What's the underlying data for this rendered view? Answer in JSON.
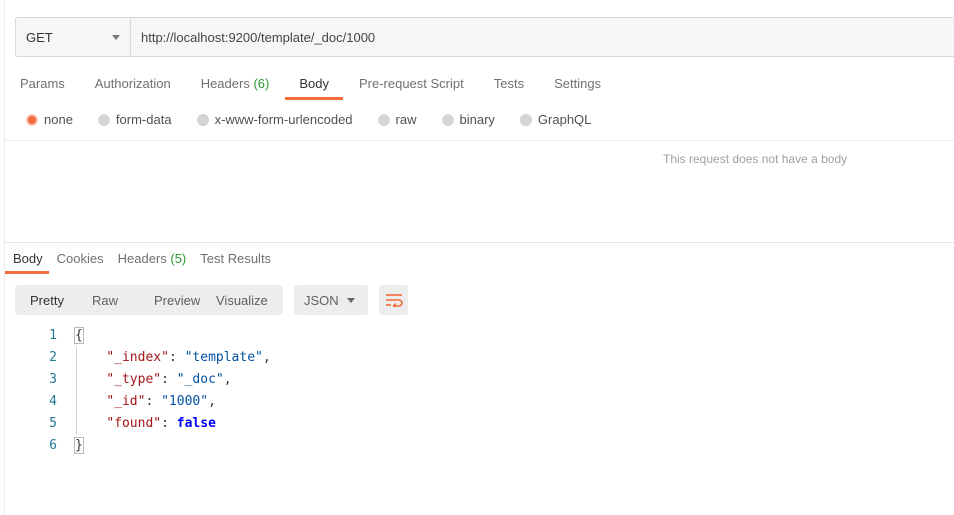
{
  "request": {
    "method": "GET",
    "url": "http://localhost:9200/template/_doc/1000"
  },
  "request_tabs": [
    {
      "label": "Params"
    },
    {
      "label": "Authorization"
    },
    {
      "label": "Headers",
      "count": "(6)"
    },
    {
      "label": "Body",
      "active": true
    },
    {
      "label": "Pre-request Script"
    },
    {
      "label": "Tests"
    },
    {
      "label": "Settings"
    }
  ],
  "body_types": [
    {
      "label": "none",
      "selected": true
    },
    {
      "label": "form-data"
    },
    {
      "label": "x-www-form-urlencoded"
    },
    {
      "label": "raw"
    },
    {
      "label": "binary"
    },
    {
      "label": "GraphQL"
    }
  ],
  "no_body_message": "This request does not have a body",
  "response_tabs": [
    {
      "label": "Body",
      "active": true
    },
    {
      "label": "Cookies"
    },
    {
      "label": "Headers",
      "count": "(5)"
    },
    {
      "label": "Test Results"
    }
  ],
  "view_modes": [
    "Pretty",
    "Raw",
    "Preview",
    "Visualize"
  ],
  "format": "JSON",
  "code_lines": [
    {
      "num": "1",
      "tokens": [
        {
          "t": "p",
          "v": "{"
        }
      ]
    },
    {
      "num": "2",
      "tokens": [
        {
          "t": "p",
          "v": "    "
        },
        {
          "t": "k",
          "v": "\"_index\""
        },
        {
          "t": "p",
          "v": ": "
        },
        {
          "t": "s",
          "v": "\"template\""
        },
        {
          "t": "p",
          "v": ","
        }
      ]
    },
    {
      "num": "3",
      "tokens": [
        {
          "t": "p",
          "v": "    "
        },
        {
          "t": "k",
          "v": "\"_type\""
        },
        {
          "t": "p",
          "v": ": "
        },
        {
          "t": "s",
          "v": "\"_doc\""
        },
        {
          "t": "p",
          "v": ","
        }
      ]
    },
    {
      "num": "4",
      "tokens": [
        {
          "t": "p",
          "v": "    "
        },
        {
          "t": "k",
          "v": "\"_id\""
        },
        {
          "t": "p",
          "v": ": "
        },
        {
          "t": "s",
          "v": "\"1000\""
        },
        {
          "t": "p",
          "v": ","
        }
      ]
    },
    {
      "num": "5",
      "tokens": [
        {
          "t": "p",
          "v": "    "
        },
        {
          "t": "k",
          "v": "\"found\""
        },
        {
          "t": "p",
          "v": ": "
        },
        {
          "t": "b",
          "v": "false"
        }
      ]
    },
    {
      "num": "6",
      "tokens": [
        {
          "t": "p",
          "v": "}"
        }
      ]
    }
  ],
  "colors": {
    "accent": "#f26b3a",
    "count_green": "#2c9a2c",
    "json_key": "#a31515",
    "json_string": "#0451a5",
    "json_bool": "#0000ff",
    "line_number": "#237893"
  }
}
